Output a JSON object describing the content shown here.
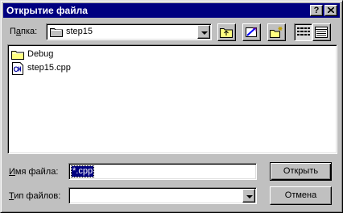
{
  "window": {
    "title": "Открытие файла",
    "help_glyph": "?",
    "close_glyph": "✕"
  },
  "lookin": {
    "label_prefix": "П",
    "label_accel": "а",
    "label_suffix": "пка:",
    "value": "step15",
    "icon": "folder-icon"
  },
  "toolbar": {
    "buttons": [
      "up-one-level-icon",
      "desktop-icon",
      "new-folder-icon",
      "list-view-icon",
      "details-view-icon"
    ]
  },
  "files": [
    {
      "name": "Debug",
      "icon": "folder-icon"
    },
    {
      "name": "step15.cpp",
      "icon": "cpp-file-icon"
    }
  ],
  "filename": {
    "label_accel": "И",
    "label_rest": "мя файла:",
    "value": "*.cpp"
  },
  "filetype": {
    "label_accel": "Т",
    "label_rest": "ип файлов:",
    "value": ""
  },
  "buttons": {
    "open": "Открыть",
    "cancel": "Отмена"
  },
  "colors": {
    "titlebar": "#000080",
    "face": "#c0c0c0",
    "selection": "#000080"
  }
}
